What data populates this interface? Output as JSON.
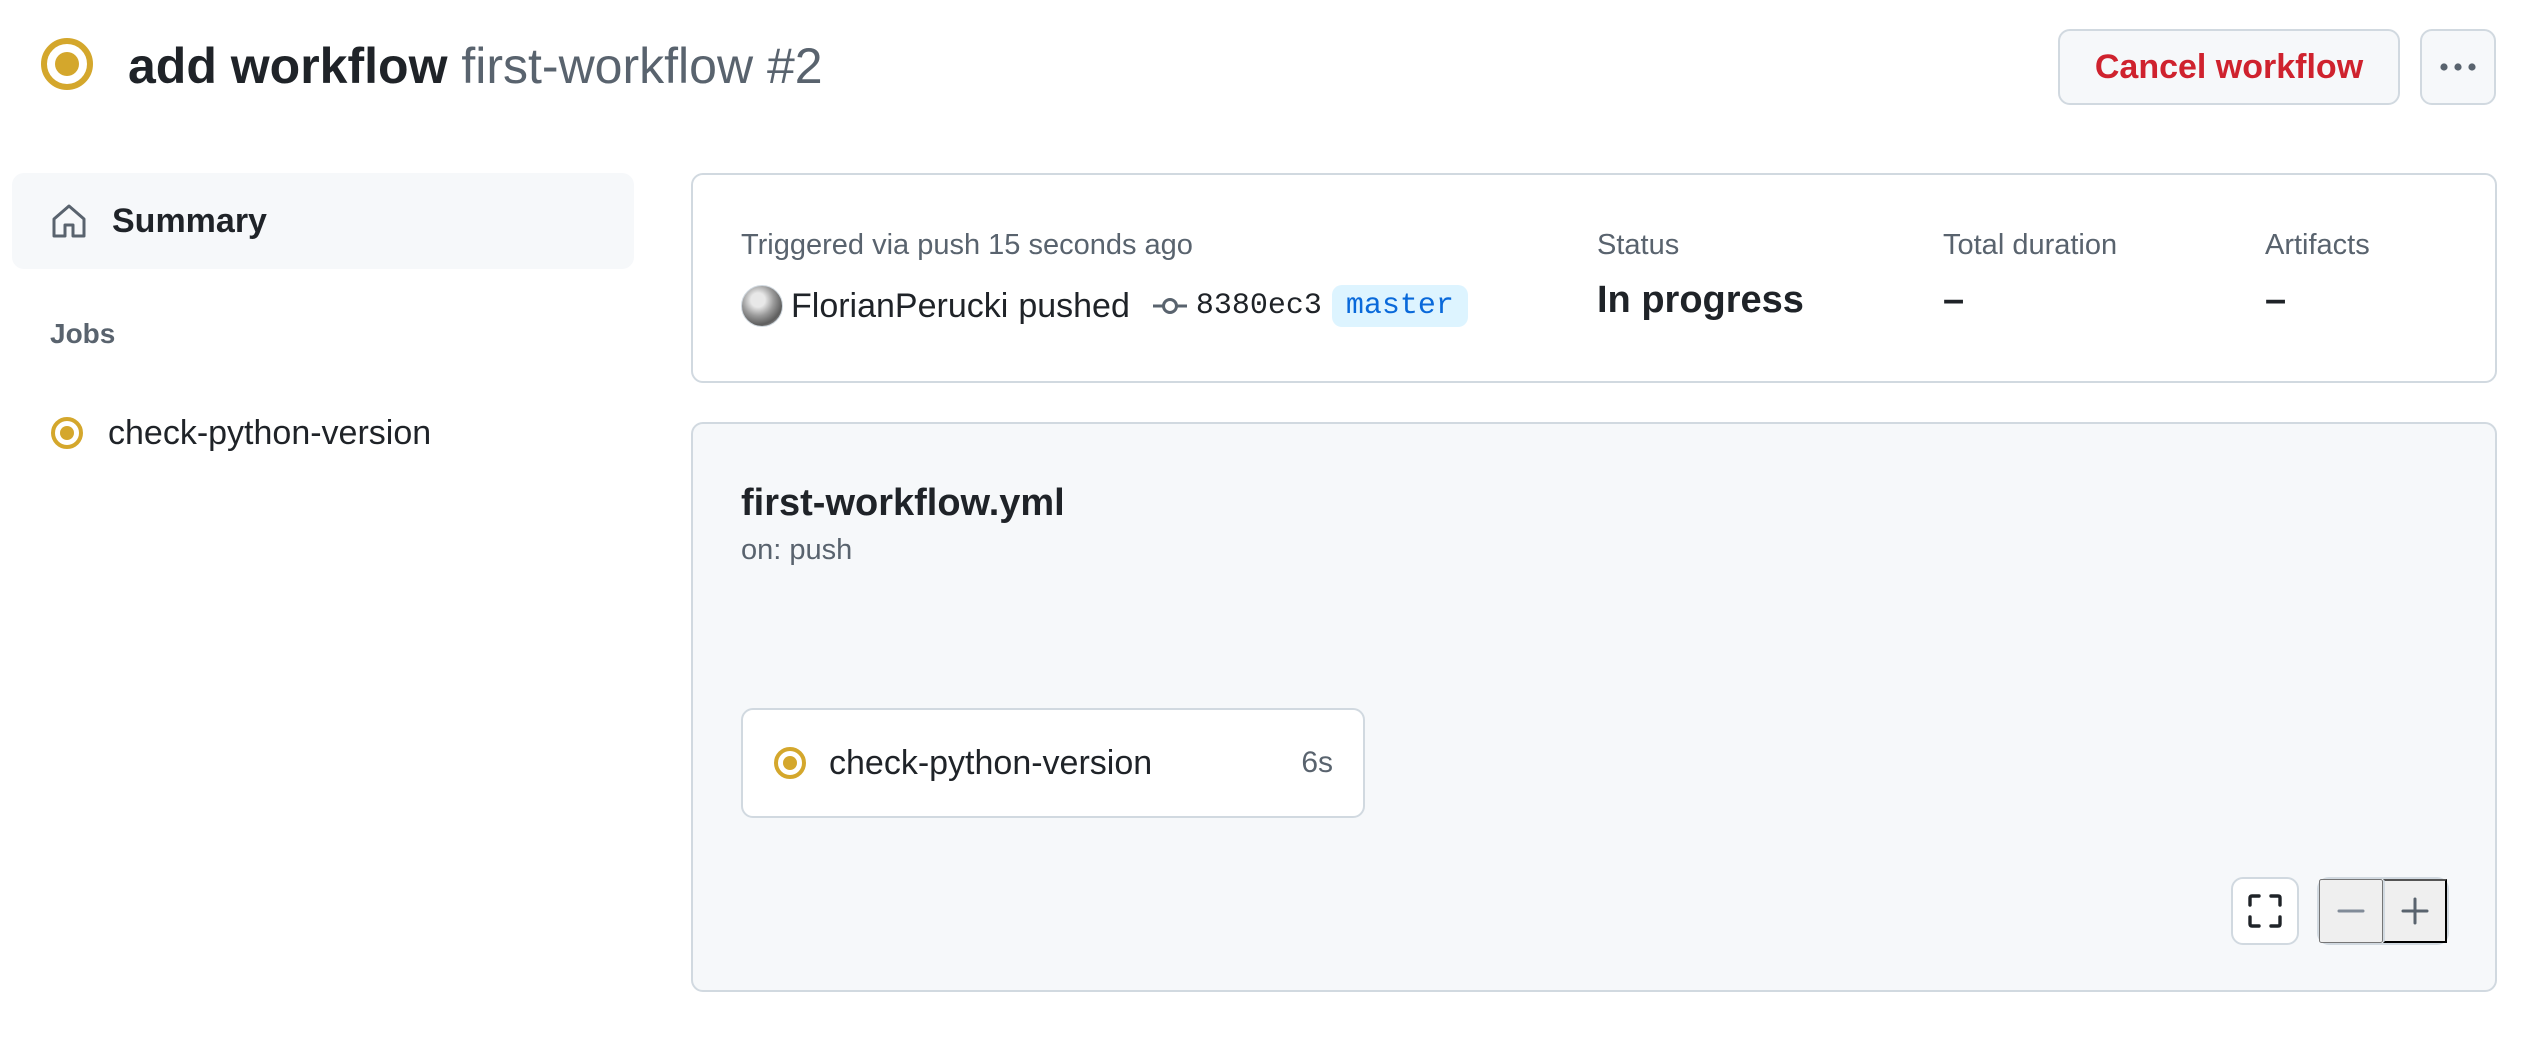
{
  "header": {
    "title_bold": "add workflow",
    "title_muted": "first-workflow #2",
    "status_icon": "in-progress-icon",
    "cancel_label": "Cancel workflow",
    "more_icon": "kebab-horizontal-icon"
  },
  "sidebar": {
    "summary_label": "Summary",
    "summary_icon": "home-icon",
    "jobs_heading": "Jobs",
    "jobs": [
      {
        "label": "check-python-version",
        "icon": "in-progress-icon"
      }
    ]
  },
  "summary": {
    "trigger_text": "Triggered via push 15 seconds ago",
    "actor": "FlorianPerucki",
    "action": "pushed",
    "commit_sha": "8380ec3",
    "branch": "master",
    "status_label": "Status",
    "status_value": "In progress",
    "duration_label": "Total duration",
    "duration_value": "–",
    "artifacts_label": "Artifacts",
    "artifacts_value": "–"
  },
  "graph": {
    "workflow_file": "first-workflow.yml",
    "trigger": "on: push",
    "jobs": [
      {
        "label": "check-python-version",
        "duration": "6s",
        "icon": "in-progress-icon"
      }
    ]
  },
  "colors": {
    "in_progress": "#d4a72c",
    "danger": "#cf222e",
    "accent": "#0969da",
    "branch_bg": "#ddf4ff",
    "muted_text": "#59636e",
    "border": "#d1d9e0",
    "canvas_subtle": "#f6f8fa"
  }
}
